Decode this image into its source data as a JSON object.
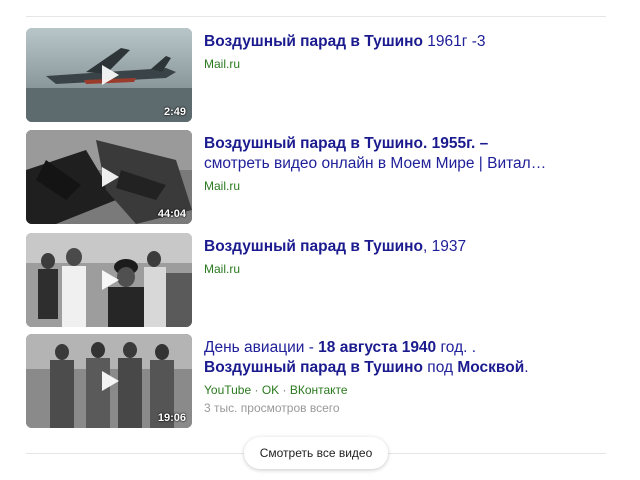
{
  "videos": [
    {
      "title_bold": "Воздушный парад в Тушино",
      "title_rest": " 1961г -3",
      "source": "Mail.ru",
      "duration": "2:49"
    },
    {
      "title_bold": "Воздушный парад в Тушино",
      "title_rest": ". 1955г. –",
      "title_line2": "смотреть видео онлайн в Моем Мире | Витал…",
      "source": "Mail.ru",
      "duration": "44:04"
    },
    {
      "title_bold": "Воздушный парад в Тушино",
      "title_rest": ", 1937",
      "source": "Mail.ru",
      "duration": ""
    },
    {
      "title_pre": "День авиации - ",
      "title_pre_bold": "18 августа 1940",
      "title_pre_rest": " год. .",
      "title_bold": "Воздушный парад в Тушино",
      "title_mid": " под ",
      "title_bold2": "Москвой",
      "title_end": ".",
      "sources": [
        "YouTube",
        "OK",
        "ВКонтакте"
      ],
      "source_separator": " · ",
      "views": "3 тыс. просмотров всего",
      "duration": "19:06"
    }
  ],
  "more_button": "Смотреть все видео"
}
